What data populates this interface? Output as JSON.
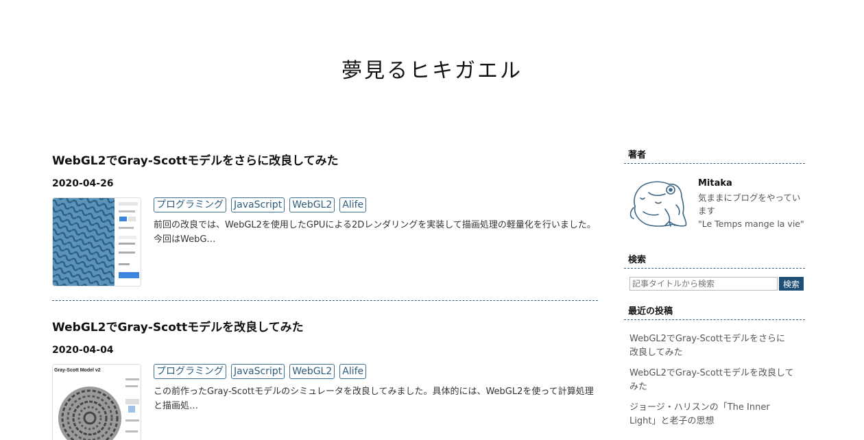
{
  "site": {
    "title": "夢見るヒキガエル"
  },
  "posts": [
    {
      "title": "WebGL2でGray-Scottモデルをさらに改良してみた",
      "date": "2020-04-26",
      "tags": [
        "プログラミング",
        "JavaScript",
        "WebGL2",
        "Alife"
      ],
      "excerpt": "前回の改良では、WebGL2を使用したGPUによる2Dレンダリングを実装して描画処理の軽量化を行いました。今回はWebG…"
    },
    {
      "title": "WebGL2でGray-Scottモデルを改良してみた",
      "date": "2020-04-04",
      "tags": [
        "プログラミング",
        "JavaScript",
        "WebGL2",
        "Alife"
      ],
      "excerpt": "この前作ったGray-Scottモデルのシミュレータを改良してみました。具体的には、WebGL2を使って計算処理と描画処…",
      "thumb_label": "Gray-Scott Model v2"
    }
  ],
  "sidebar": {
    "author_heading": "著者",
    "author_name": "Mitaka",
    "author_desc": "気ままにブログをやっています",
    "author_quote": "\"Le Temps mange la vie\"",
    "search_heading": "検索",
    "search_placeholder": "記事タイトルから検索",
    "search_button": "検索",
    "recent_heading": "最近の投稿",
    "recent_posts": [
      "WebGL2でGray-Scottモデルをさらに改良してみた",
      "WebGL2でGray-Scottモデルを改良してみた",
      "ジョージ・ハリスンの「The Inner Light」と老子の思想"
    ]
  },
  "colors": {
    "tag_border": "#3b6e8f",
    "separator": "#2e5f80",
    "search_button_bg": "#1f4f75",
    "thumb_pattern": "#4a86b0"
  },
  "icons": {
    "avatar": "toad-illustration-icon"
  }
}
